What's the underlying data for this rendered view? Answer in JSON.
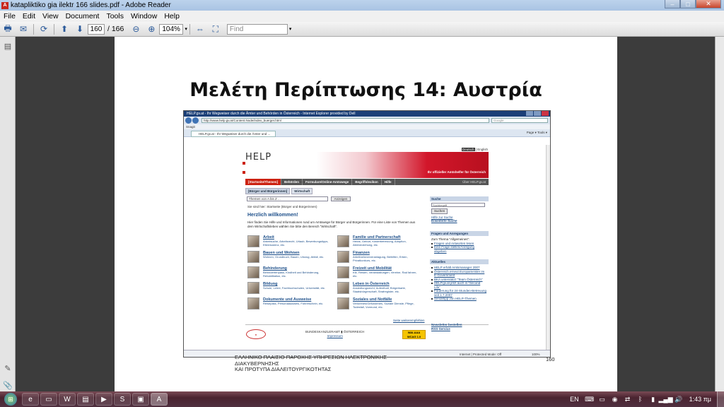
{
  "window": {
    "title": "katapliktiko gia ilektr 166 slides.pdf - Adobe Reader",
    "app_icon": "adobe-reader-icon"
  },
  "menu": [
    "File",
    "Edit",
    "View",
    "Document",
    "Tools",
    "Window",
    "Help"
  ],
  "toolbar": {
    "page_current": "160",
    "page_total": "/ 166",
    "zoom": "104%",
    "find_placeholder": "Find"
  },
  "slide": {
    "title": "Μελέτη Περίπτωσης 14: Αυστρία",
    "footer_line1": "ΕΛΛΗΝΙΚΟ ΠΛΑΙΣΙΟ ΠΑΡΟΧΗΣ ΥΠΗΡΕΣΙΩΝ ΗΛΕΚΤΡΟΝΙΚΗΣ ΔΙΑΚΥΒΕΡΝΗΣΗΣ",
    "footer_line2": "ΚΑΙ ΠΡΟΤΥΠΑ ΔΙΑΛΕΙΤΟΥΡΓΙΚΟΤΗΤΑΣ",
    "page_number": "160"
  },
  "browser": {
    "title": "HELP.gv.at - Ihr Wegweiser durch die Ämter und Behörden in Österreich - Internet Explorer provided by Dell",
    "url": "http://www.help.gv.at/Content.Node/index_buerger.html",
    "search_placeholder": "Google",
    "links": "Snagit",
    "tab": "HELP.gv.at - Ihr Wegweiser durch die Ämter und ...",
    "commands": "Page ▾  Tools ▾",
    "status_zone": "Internet | Protected Mode: Off",
    "status_zoom": "100%"
  },
  "site": {
    "lang_de": "Deutsch",
    "lang_en": "English",
    "logo": "HELP",
    "slogan": "Ihr offizieller Amtshelfer für Österreich",
    "nav": [
      "[Startseite/Themen]",
      "Behörden",
      "Formulare/Online-Amtswege",
      "Begriffslexikon",
      "Hilfe"
    ],
    "nav_right": "Über HELP.gv.at",
    "subtabs": [
      "[Bürger und Bürgerinnen]",
      "Wirtschaft"
    ],
    "themen_select": "Themen von A bis Z ...",
    "anzeigen": "Anzeigen",
    "crumb": "Sie sind hier: Startseite (Bürger und Bürgerinnen)",
    "welcome": "Herzlich willkommen!",
    "intro": "Hier finden Sie Hilfe und Informationen rund um Amtswege für Bürger und Bürgerinnen. Für eine Liste von Themen aus dem Wirtschaftsleben wählen Sie bitte den Bereich \"Wirtschaft\".",
    "categories": [
      {
        "title": "Arbeit",
        "desc": "Arbeitsuche, Arbeitsrecht, Urlaub, Bewerbungstipps, Elternkarenz, etc."
      },
      {
        "title": "Familie und Partnerschaft",
        "desc": "Heirat, Geburt, Kinderbetreuung, Adoption, Alleinerziehung, etc."
      },
      {
        "title": "Bauen und Wohnen",
        "desc": "Wohnen, Grundbuch, Bauen, Umzug, Abfall, etc."
      },
      {
        "title": "Finanzen",
        "desc": "Arbeitnehmerveranlagung, Beihilfen, Erben, Privatkonkurs, etc."
      },
      {
        "title": "Behinderung",
        "desc": "Behindertenpass, Kindheit und Behinderung, Rehabilitation, etc."
      },
      {
        "title": "Freizeit und Mobilität",
        "desc": "Kfz, Reisen, Veranstaltungen, Vereine, Rad fahren, etc."
      },
      {
        "title": "Bildung",
        "desc": "Schule, Lehre, Fachhochschulen, Universität, etc."
      },
      {
        "title": "Leben in Österreich",
        "desc": "Ansiedlungsrecht, Aufenthalt, Bürgerkarte, Staatsbürgerschaft, Strafregister, etc."
      },
      {
        "title": "Dokumente und Ausweise",
        "desc": "Reisepass, Personalausweis, Führerschein, etc."
      },
      {
        "title": "Soziales und Notfälle",
        "desc": "Verlorenes/Gefundenes, Soziale Dienste, Pflege, Todesfall, Vormund, etc."
      }
    ],
    "seite": "Seite weiterempfehlen",
    "footer_bka": "BUNDESKANZLERAMT ▮ ÖSTERREICH",
    "footer_impressum": "Impressum",
    "footer_waiaa": "WAI-AAA WCAG 1.0",
    "sidebar": {
      "suche_title": "Suche",
      "suche_input": "Suchbegriff",
      "suche_btn": "Suchen",
      "suche_link1": "Hilfe zur Suche",
      "suche_link2": "Erweiterte Suche",
      "fragen_title": "Fragen und Anregungen",
      "fragen_text": "Zum Thema \"Allgemeines\":",
      "fragen_items": [
        "Fragen und Antworten lesen",
        "Eine Frage stellen/Anregung abgeben"
      ],
      "aktuelles_title": "Aktuelles",
      "aktuelles_items": [
        "HELP erhält Amtsmanager 2007",
        "Österreich erneut Europameister im E-Government",
        "BKA unterstützt \"Team Österreich\"",
        "HELP.gv.at jetzt auch in \"Second Life\"",
        "Förderung für 24-Stunden-Betreuung seit 1.7.2007",
        "Sendetipp von HELP-Themen"
      ],
      "newsletter": "Newsletter bestellen",
      "rss": "RSS-Service"
    }
  },
  "taskbar": {
    "apps": [
      "ie-icon",
      "folder-icon",
      "word-icon",
      "explorer-icon",
      "media-icon",
      "skype-icon",
      "acrobat-icon",
      "adobe-reader-icon"
    ],
    "lang": "EN",
    "clock": "1:43 πμ"
  }
}
